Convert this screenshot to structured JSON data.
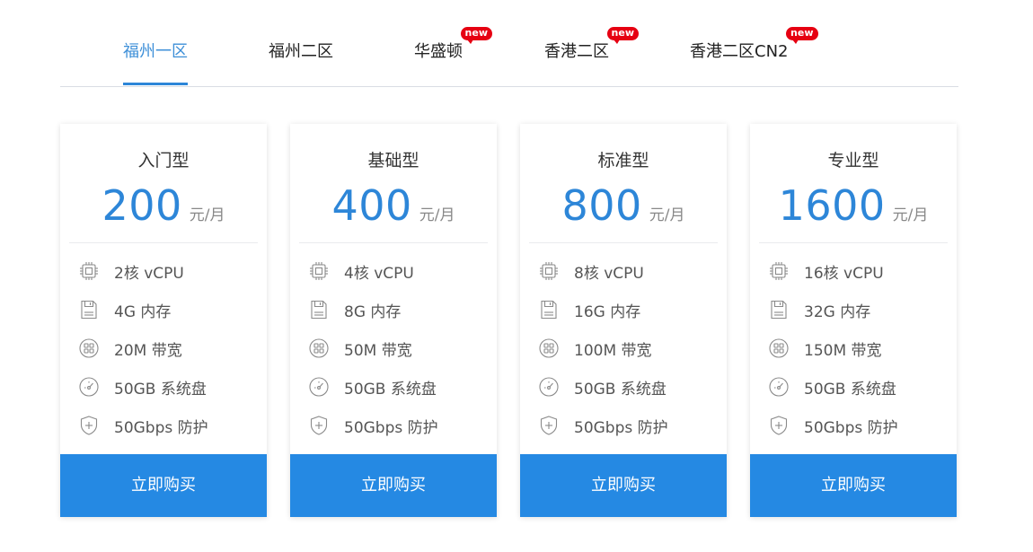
{
  "tabs": [
    {
      "label": "福州一区",
      "active": true,
      "badge": ""
    },
    {
      "label": "福州二区",
      "active": false,
      "badge": ""
    },
    {
      "label": "华盛顿",
      "active": false,
      "badge": "new"
    },
    {
      "label": "香港二区",
      "active": false,
      "badge": "new"
    },
    {
      "label": "香港二区CN2",
      "active": false,
      "badge": "new"
    }
  ],
  "colors": {
    "accent": "#2d86d8",
    "button": "#2589e3",
    "badge": "#e60012"
  },
  "plans": [
    {
      "title": "入门型",
      "price": "200",
      "unit": "元/月",
      "specs": [
        "2核 vCPU",
        "4G 内存",
        "20M 带宽",
        "50GB 系统盘",
        "50Gbps 防护"
      ],
      "button": "立即购买"
    },
    {
      "title": "基础型",
      "price": "400",
      "unit": "元/月",
      "specs": [
        "4核 vCPU",
        "8G 内存",
        "50M 带宽",
        "50GB 系统盘",
        "50Gbps 防护"
      ],
      "button": "立即购买"
    },
    {
      "title": "标准型",
      "price": "800",
      "unit": "元/月",
      "specs": [
        "8核 vCPU",
        "16G 内存",
        "100M 带宽",
        "50GB 系统盘",
        "50Gbps 防护"
      ],
      "button": "立即购买"
    },
    {
      "title": "专业型",
      "price": "1600",
      "unit": "元/月",
      "specs": [
        "16核 vCPU",
        "32G 内存",
        "150M 带宽",
        "50GB 系统盘",
        "50Gbps 防护"
      ],
      "button": "立即购买"
    }
  ],
  "spec_icons": [
    "cpu-icon",
    "memory-icon",
    "bandwidth-icon",
    "disk-icon",
    "shield-icon"
  ]
}
